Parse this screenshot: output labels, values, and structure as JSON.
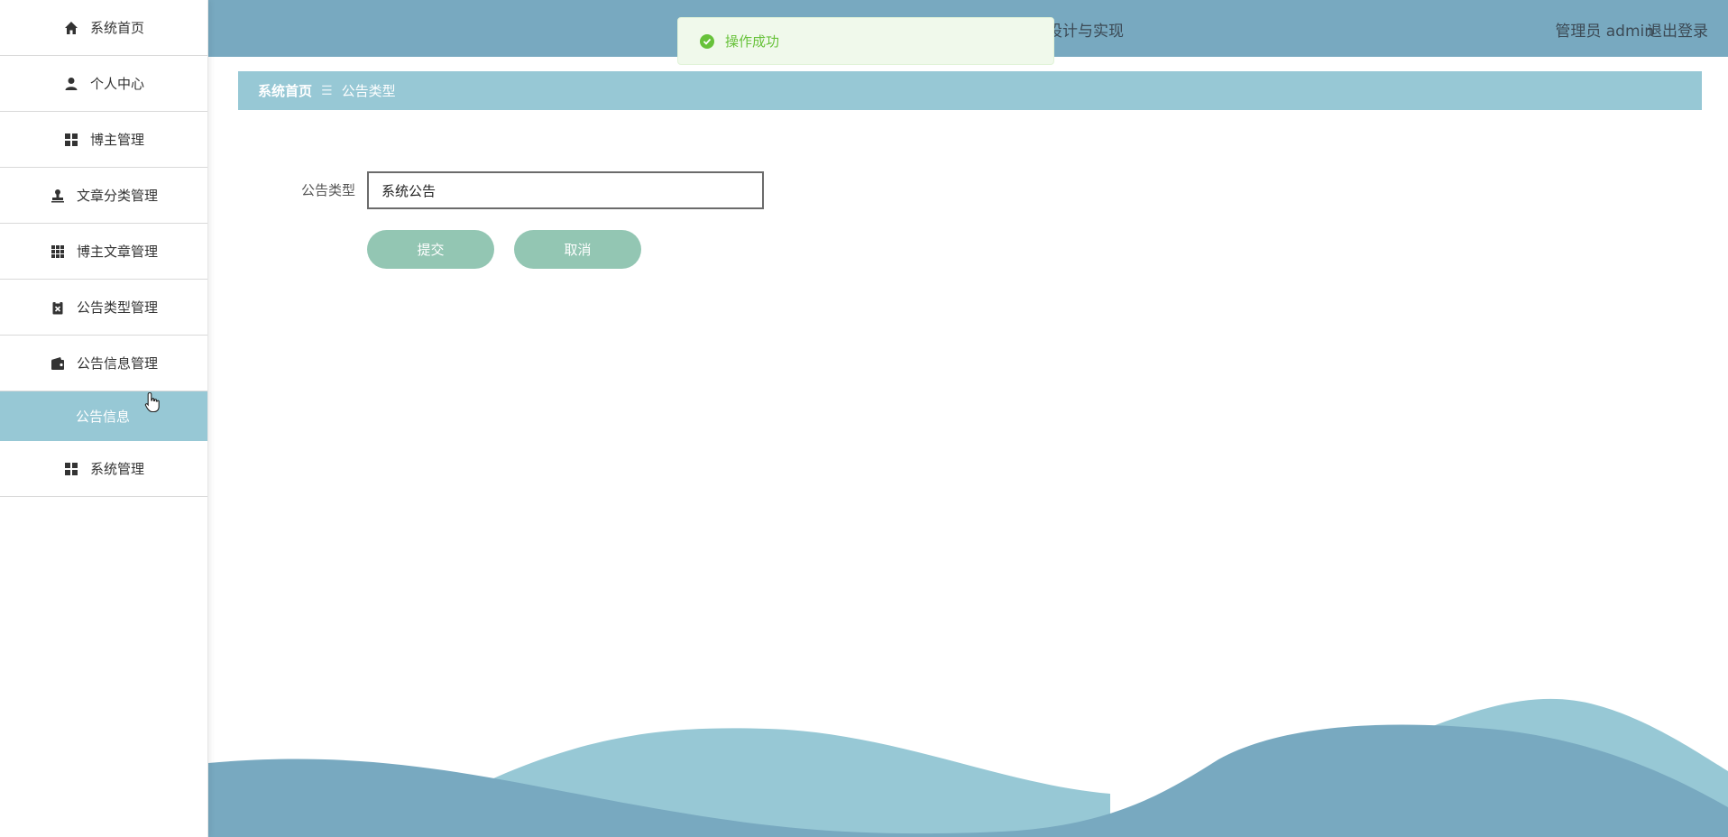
{
  "sidebar": {
    "items": [
      {
        "label": "系统首页",
        "icon": "home-icon"
      },
      {
        "label": "个人中心",
        "icon": "user-icon"
      },
      {
        "label": "博主管理",
        "icon": "grid-icon"
      },
      {
        "label": "文章分类管理",
        "icon": "stamp-icon"
      },
      {
        "label": "博主文章管理",
        "icon": "apps-icon"
      },
      {
        "label": "公告类型管理",
        "icon": "clipboard-icon"
      },
      {
        "label": "公告信息管理",
        "icon": "wallet-icon"
      }
    ],
    "subitem": {
      "label": "公告信息"
    },
    "last_item": {
      "label": "系统管理",
      "icon": "grid-icon"
    }
  },
  "header": {
    "title": "设计与实现",
    "user": "管理员 admin",
    "logout": "退出登录",
    "bg_color": "#78a9c0"
  },
  "toast": {
    "message": "操作成功",
    "color": "#67c23a"
  },
  "breadcrumb": {
    "home": "系统首页",
    "separator": "☰",
    "current": "公告类型"
  },
  "form": {
    "label": "公告类型",
    "value": "系统公告",
    "submit": "提交",
    "cancel": "取消"
  },
  "colors": {
    "accent": "#97c8d5",
    "button": "#93c6b3",
    "wave_dark": "#78a9c0"
  }
}
